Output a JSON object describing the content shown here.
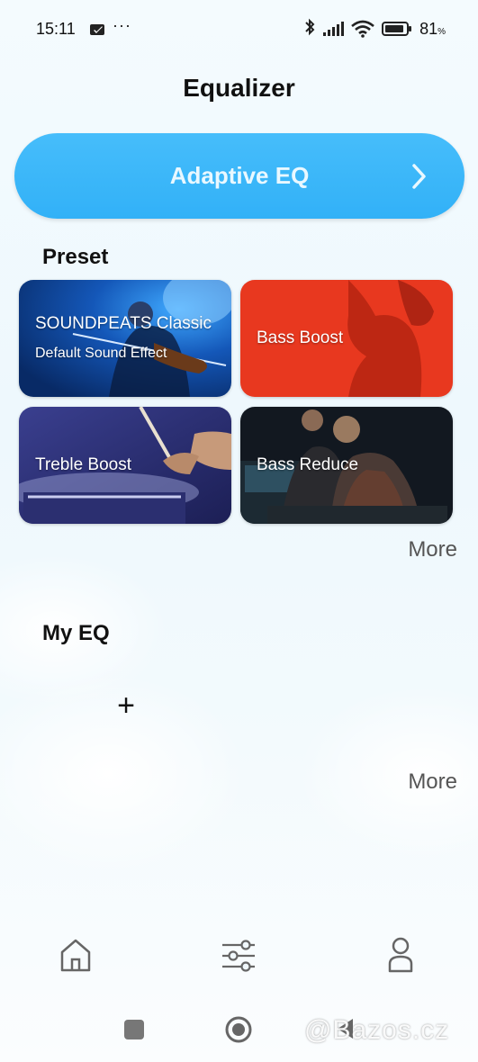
{
  "status_bar": {
    "time": "15:11",
    "dots": "···",
    "battery_level": "81",
    "battery_unit": "%",
    "icons": [
      "mail-icon",
      "bluetooth-icon",
      "signal-icon",
      "wifi-icon",
      "battery-icon"
    ]
  },
  "header": {
    "title": "Equalizer"
  },
  "adaptive_eq": {
    "label": "Adaptive EQ",
    "icon": "chevron-right-icon",
    "color": "#3bb6f9"
  },
  "preset": {
    "title": "Preset",
    "cards": [
      {
        "label": "SOUNDPEATS Classic",
        "sublabel": "Default Sound Effect",
        "theme": "violinist-blue"
      },
      {
        "label": "Bass Boost",
        "theme": "singer-red"
      },
      {
        "label": "Treble Boost",
        "theme": "drummer-purple"
      },
      {
        "label": "Bass Reduce",
        "theme": "studio-dark"
      }
    ],
    "more": "More"
  },
  "my_eq": {
    "title": "My EQ",
    "add": "+",
    "more": "More"
  },
  "bottom_nav": {
    "items": [
      "home-icon",
      "equalizer-sliders-icon",
      "profile-icon"
    ]
  },
  "system_nav": {
    "items": [
      "recent-apps-icon",
      "home-circle-icon",
      "back-icon"
    ]
  },
  "watermark": "@Bazos.cz"
}
